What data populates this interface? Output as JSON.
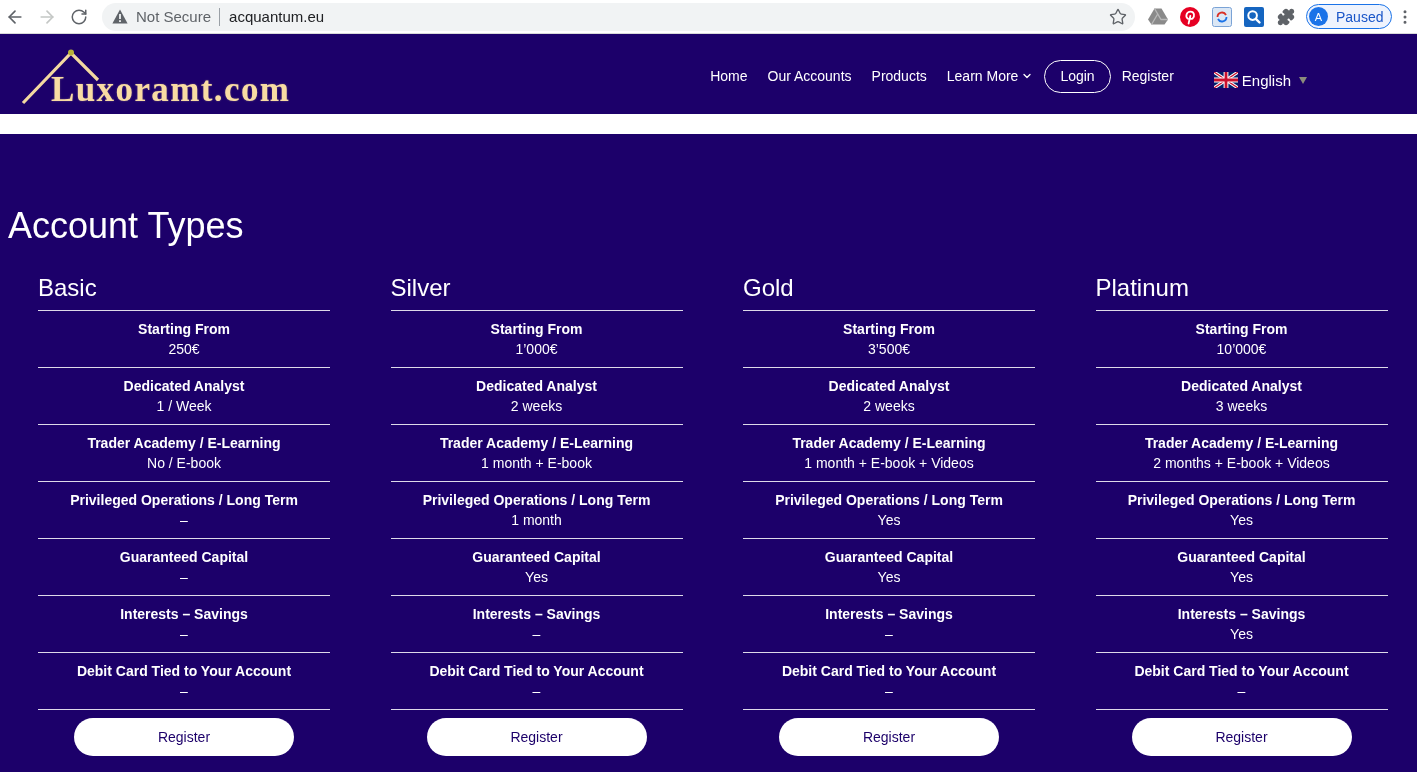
{
  "browser": {
    "nav_buttons": [
      {
        "kind": "back",
        "disabled": false
      },
      {
        "kind": "forward",
        "disabled": true
      },
      {
        "kind": "reload",
        "disabled": false
      }
    ],
    "security_label": "Not Secure",
    "url": "acquantum.eu",
    "profile": {
      "initial": "A",
      "status": "Paused"
    }
  },
  "header": {
    "logo": "Luxoramt.com",
    "nav": [
      {
        "label": "Home",
        "kind": "link"
      },
      {
        "label": "Our Accounts",
        "kind": "link"
      },
      {
        "label": "Products",
        "kind": "link"
      },
      {
        "label": "Learn More",
        "kind": "dropdown"
      },
      {
        "label": "Login",
        "kind": "outlined"
      },
      {
        "label": "Register",
        "kind": "link"
      }
    ],
    "language": "English"
  },
  "page_title": "Account Types",
  "plans": [
    {
      "name": "Basic",
      "features": [
        {
          "label": "Starting From",
          "value": "250€"
        },
        {
          "label": "Dedicated Analyst",
          "value": "1 / Week"
        },
        {
          "label": "Trader Academy / E-Learning",
          "value": "No / E-book"
        },
        {
          "label": "Privileged Operations / Long Term",
          "value": "–"
        },
        {
          "label": "Guaranteed Capital",
          "value": "–"
        },
        {
          "label": "Interests – Savings",
          "value": "–"
        },
        {
          "label": "Debit Card Tied to Your Account",
          "value": "–"
        }
      ],
      "button": "Register"
    },
    {
      "name": "Silver",
      "features": [
        {
          "label": "Starting From",
          "value": "1’000€"
        },
        {
          "label": "Dedicated Analyst",
          "value": "2 weeks"
        },
        {
          "label": "Trader Academy / E-Learning",
          "value": "1 month + E-book"
        },
        {
          "label": "Privileged Operations / Long Term",
          "value": "1 month"
        },
        {
          "label": "Guaranteed Capital",
          "value": "Yes"
        },
        {
          "label": "Interests – Savings",
          "value": "–"
        },
        {
          "label": "Debit Card Tied to Your Account",
          "value": "–"
        }
      ],
      "button": "Register"
    },
    {
      "name": "Gold",
      "features": [
        {
          "label": "Starting From",
          "value": "3’500€"
        },
        {
          "label": "Dedicated Analyst",
          "value": "2 weeks"
        },
        {
          "label": "Trader Academy / E-Learning",
          "value": "1 month + E-book + Videos"
        },
        {
          "label": "Privileged Operations / Long Term",
          "value": "Yes"
        },
        {
          "label": "Guaranteed Capital",
          "value": "Yes"
        },
        {
          "label": "Interests – Savings",
          "value": "–"
        },
        {
          "label": "Debit Card Tied to Your Account",
          "value": "–"
        }
      ],
      "button": "Register"
    },
    {
      "name": "Platinum",
      "features": [
        {
          "label": "Starting From",
          "value": "10’000€"
        },
        {
          "label": "Dedicated Analyst",
          "value": "3 weeks"
        },
        {
          "label": "Trader Academy / E-Learning",
          "value": "2 months + E-book + Videos"
        },
        {
          "label": "Privileged Operations / Long Term",
          "value": "Yes"
        },
        {
          "label": "Guaranteed Capital",
          "value": "Yes"
        },
        {
          "label": "Interests – Savings",
          "value": "Yes"
        },
        {
          "label": "Debit Card Tied to Your Account",
          "value": "–"
        }
      ],
      "button": "Register"
    }
  ]
}
